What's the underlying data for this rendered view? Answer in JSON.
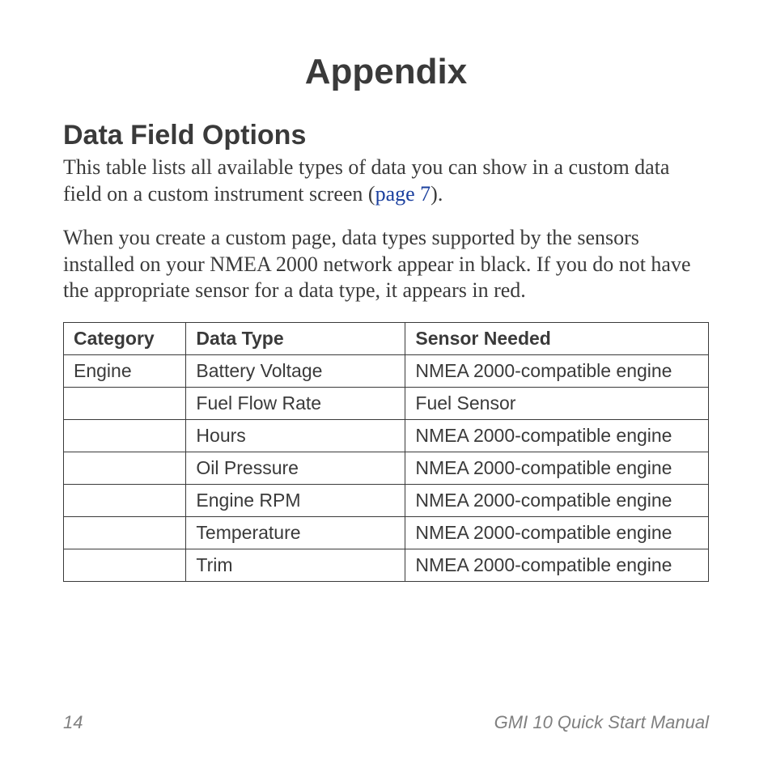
{
  "title": "Appendix",
  "section_heading": "Data Field Options",
  "para1_a": "This table lists all available types of data you can show in a custom data field on a custom instrument screen (",
  "para1_link": "page 7",
  "para1_b": ").",
  "para2": "When you create a custom page, data types supported by the sensors installed on your NMEA 2000 network appear in black. If you do not have the appropriate sensor for a data type, it appears in red.",
  "table": {
    "headers": {
      "c1": "Category",
      "c2": "Data Type",
      "c3": "Sensor Needed"
    },
    "rows": [
      {
        "c1": "Engine",
        "c2": "Battery Voltage",
        "c3": "NMEA 2000-compatible engine"
      },
      {
        "c1": "",
        "c2": "Fuel Flow Rate",
        "c3": "Fuel Sensor"
      },
      {
        "c1": "",
        "c2": "Hours",
        "c3": "NMEA 2000-compatible engine"
      },
      {
        "c1": "",
        "c2": "Oil Pressure",
        "c3": "NMEA 2000-compatible engine"
      },
      {
        "c1": "",
        "c2": "Engine RPM",
        "c3": "NMEA 2000-compatible engine"
      },
      {
        "c1": "",
        "c2": "Temperature",
        "c3": "NMEA 2000-compatible engine"
      },
      {
        "c1": "",
        "c2": "Trim",
        "c3": "NMEA 2000-compatible engine"
      }
    ]
  },
  "footer": {
    "page_number": "14",
    "doc_title": "GMI 10 Quick Start Manual"
  }
}
